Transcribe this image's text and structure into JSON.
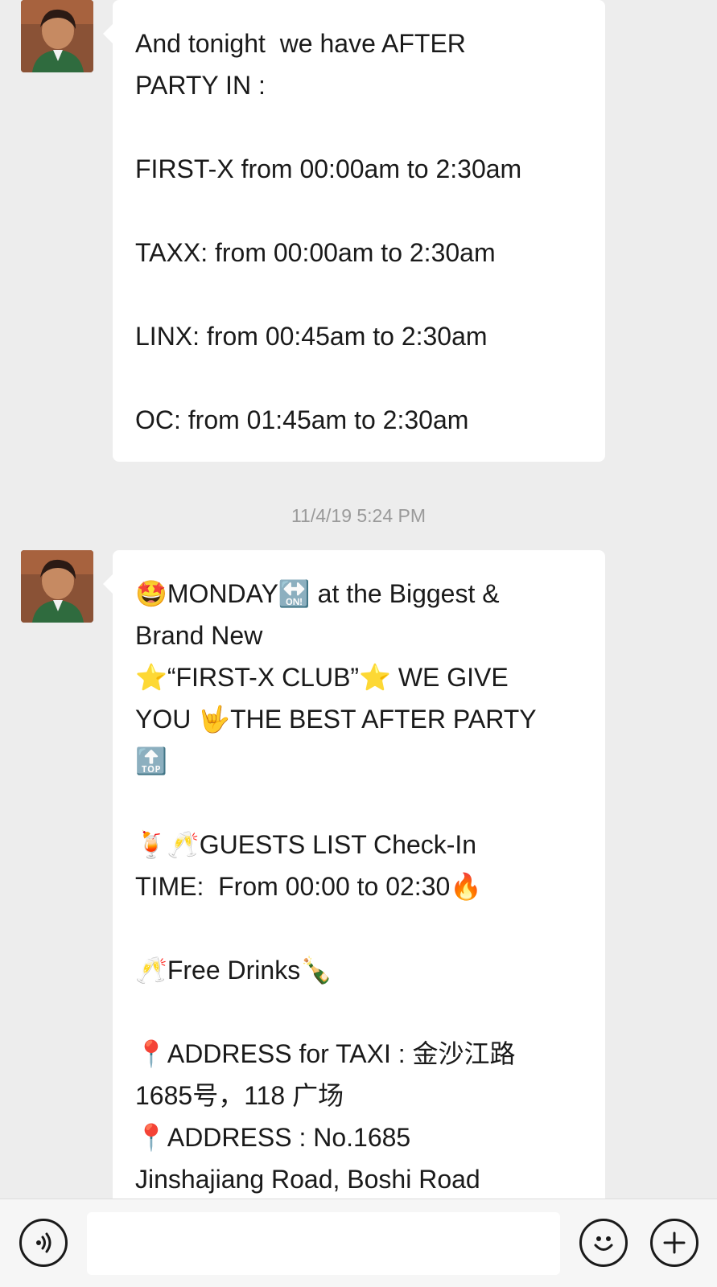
{
  "messages": [
    {
      "lines": [
        "And tonight  we have AFTER",
        "PARTY IN :",
        "",
        "FIRST-X from 00:00am to 2:30am",
        "",
        "TAXX: from 00:00am to 2:30am",
        "",
        "LINX: from 00:45am to 2:30am",
        "",
        "OC: from 01:45am to 2:30am"
      ]
    },
    {
      "timestamp": "11/4/19 5:24 PM",
      "lines": [
        "🤩MONDAY🔛 at the Biggest &",
        "Brand New",
        "⭐“FIRST-X CLUB”⭐ WE GIVE",
        "YOU 🤟THE BEST AFTER PARTY",
        "🔝",
        "",
        "🍹🥂GUESTS LIST Check-In",
        "TIME:  From 00:00 to 02:30🔥",
        "",
        "🥂Free Drinks🍾",
        "",
        "📍ADDRESS for TAXI : 金沙江路",
        "1685号，118 广场",
        "📍ADDRESS : No.1685",
        "Jinshajiang Road, Boshi Road"
      ]
    }
  ],
  "input_bar": {
    "message_value": "",
    "icons": [
      "voice-icon",
      "emoji-icon",
      "plus-icon"
    ]
  }
}
